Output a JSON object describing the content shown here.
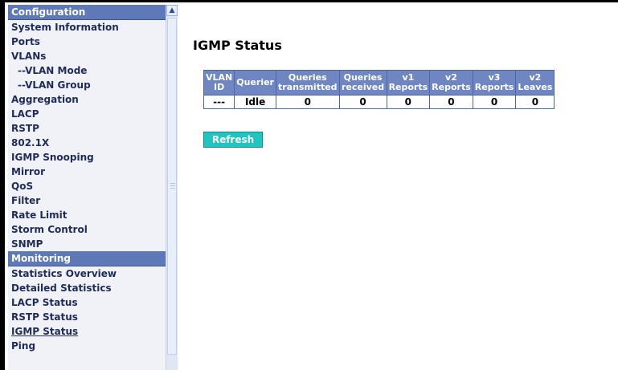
{
  "sidebar": {
    "sections": [
      {
        "header": "Configuration",
        "items": [
          {
            "label": "System Information",
            "sub": false
          },
          {
            "label": "Ports",
            "sub": false
          },
          {
            "label": "VLANs",
            "sub": false
          },
          {
            "label": "--VLAN Mode",
            "sub": true
          },
          {
            "label": "--VLAN Group",
            "sub": true
          },
          {
            "label": "Aggregation",
            "sub": false
          },
          {
            "label": "LACP",
            "sub": false
          },
          {
            "label": "RSTP",
            "sub": false
          },
          {
            "label": "802.1X",
            "sub": false
          },
          {
            "label": "IGMP Snooping",
            "sub": false
          },
          {
            "label": "Mirror",
            "sub": false
          },
          {
            "label": "QoS",
            "sub": false
          },
          {
            "label": "Filter",
            "sub": false
          },
          {
            "label": "Rate Limit",
            "sub": false
          },
          {
            "label": "Storm Control",
            "sub": false
          },
          {
            "label": "SNMP",
            "sub": false
          }
        ]
      },
      {
        "header": "Monitoring",
        "items": [
          {
            "label": "Statistics Overview",
            "sub": false
          },
          {
            "label": "Detailed Statistics",
            "sub": false
          },
          {
            "label": "LACP Status",
            "sub": false
          },
          {
            "label": "RSTP Status",
            "sub": false
          },
          {
            "label": "IGMP Status",
            "sub": false,
            "active": true
          },
          {
            "label": "Ping",
            "sub": false
          }
        ]
      }
    ]
  },
  "main": {
    "title": "IGMP Status",
    "table": {
      "headers": [
        [
          "VLAN",
          "ID"
        ],
        [
          "Querier"
        ],
        [
          "Queries",
          "transmitted"
        ],
        [
          "Queries",
          "received"
        ],
        [
          "v1",
          "Reports"
        ],
        [
          "v2",
          "Reports"
        ],
        [
          "v3",
          "Reports"
        ],
        [
          "v2",
          "Leaves"
        ]
      ],
      "rows": [
        [
          "---",
          "Idle",
          "0",
          "0",
          "0",
          "0",
          "0",
          "0"
        ]
      ]
    },
    "refresh_label": "Refresh"
  }
}
